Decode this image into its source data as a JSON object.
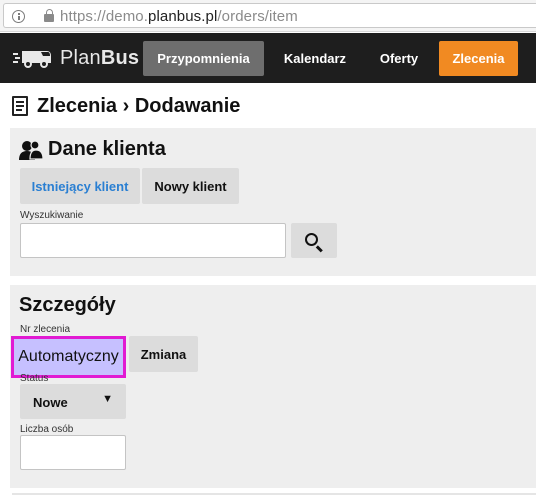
{
  "browser": {
    "url_scheme": "https://demo.",
    "url_domain": "planbus.pl",
    "url_path": "/orders/item"
  },
  "nav": {
    "brand_light": "Plan",
    "brand_bold": "Bus",
    "items": [
      {
        "label": "Przypomnienia",
        "state": "grey"
      },
      {
        "label": "Kalendarz",
        "state": "normal"
      },
      {
        "label": "Oferty",
        "state": "normal"
      },
      {
        "label": "Zlecenia",
        "state": "orange"
      }
    ]
  },
  "page": {
    "title": "Zlecenia › Dodawanie"
  },
  "client": {
    "heading": "Dane klienta",
    "existing_button": "Istniejący klient",
    "new_button": "Nowy klient",
    "search_label": "Wyszukiwanie",
    "search_value": ""
  },
  "details": {
    "heading": "Szczegóły",
    "number_label": "Nr zlecenia",
    "number_value": "Automatyczny",
    "change_button": "Zmiana",
    "status_label": "Status",
    "status_value": "Nowe",
    "people_label": "Liczba osób",
    "people_value": ""
  },
  "colors": {
    "accent_orange": "#f18a22",
    "link_blue": "#2a7fd2",
    "highlight_border": "#e11ad2"
  }
}
